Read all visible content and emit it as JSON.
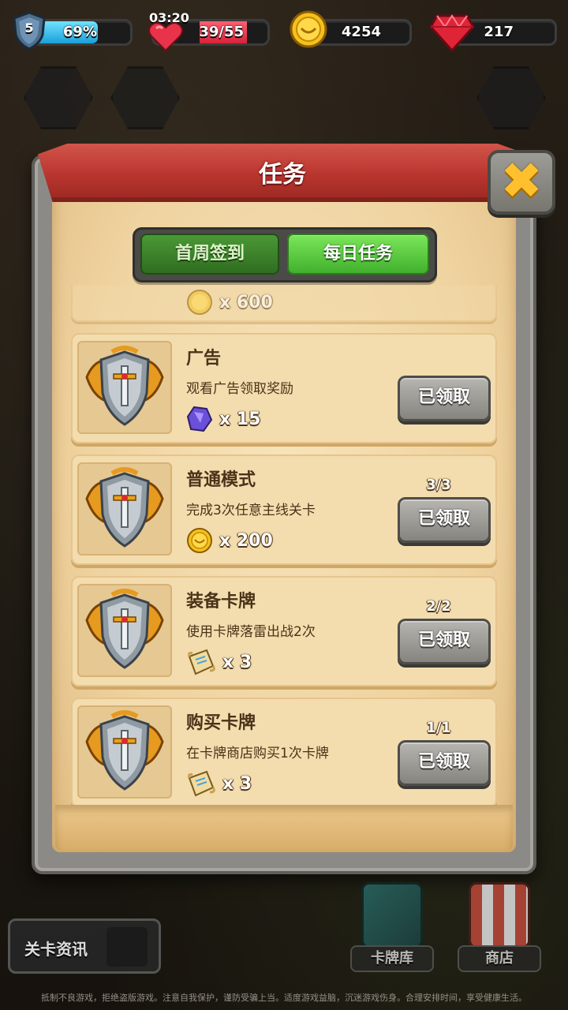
{
  "hud": {
    "level": "5",
    "xp_percent_label": "69%",
    "xp_fraction": 0.69,
    "energy_timer": "03:20",
    "energy": "39/55",
    "coins": "4254",
    "gems": "217"
  },
  "dialog": {
    "title": "任务",
    "close_icon": "close-x-icon",
    "tabs": [
      {
        "label": "首周签到",
        "active": false
      },
      {
        "label": "每日任务",
        "active": true
      }
    ],
    "partial_reward_amount": "x 600",
    "tasks": [
      {
        "title": "广告",
        "description": "观看广告领取奖励",
        "reward_icon": "purple-gem-icon",
        "reward_amount": "x 15",
        "progress": "",
        "button": "已领取"
      },
      {
        "title": "普通模式",
        "description": "完成3次任意主线关卡",
        "reward_icon": "gold-coin-icon",
        "reward_amount": "x 200",
        "progress": "3/3",
        "button": "已领取"
      },
      {
        "title": "装备卡牌",
        "description": "使用卡牌落雷出战2次",
        "reward_icon": "scroll-icon",
        "reward_amount": "x 3",
        "progress": "2/2",
        "button": "已领取"
      },
      {
        "title": "购买卡牌",
        "description": "在卡牌商店购买1次卡牌",
        "reward_icon": "scroll-icon",
        "reward_amount": "x 3",
        "progress": "1/1",
        "button": "已领取"
      }
    ]
  },
  "bottom": {
    "level_info": "关卡资讯",
    "card_library": "卡牌库",
    "shop": "商店",
    "notice": "抵制不良游戏，拒绝盗版游戏。注意自我保护，谨防受骗上当。适度游戏益脑，沉迷游戏伤身。合理安排时间，享受健康生活。"
  },
  "colors": {
    "banner_red": "#b8352e",
    "tab_green": "#3fae2b",
    "parchment": "#efd3a0",
    "claimed_gray": "#85847f"
  }
}
